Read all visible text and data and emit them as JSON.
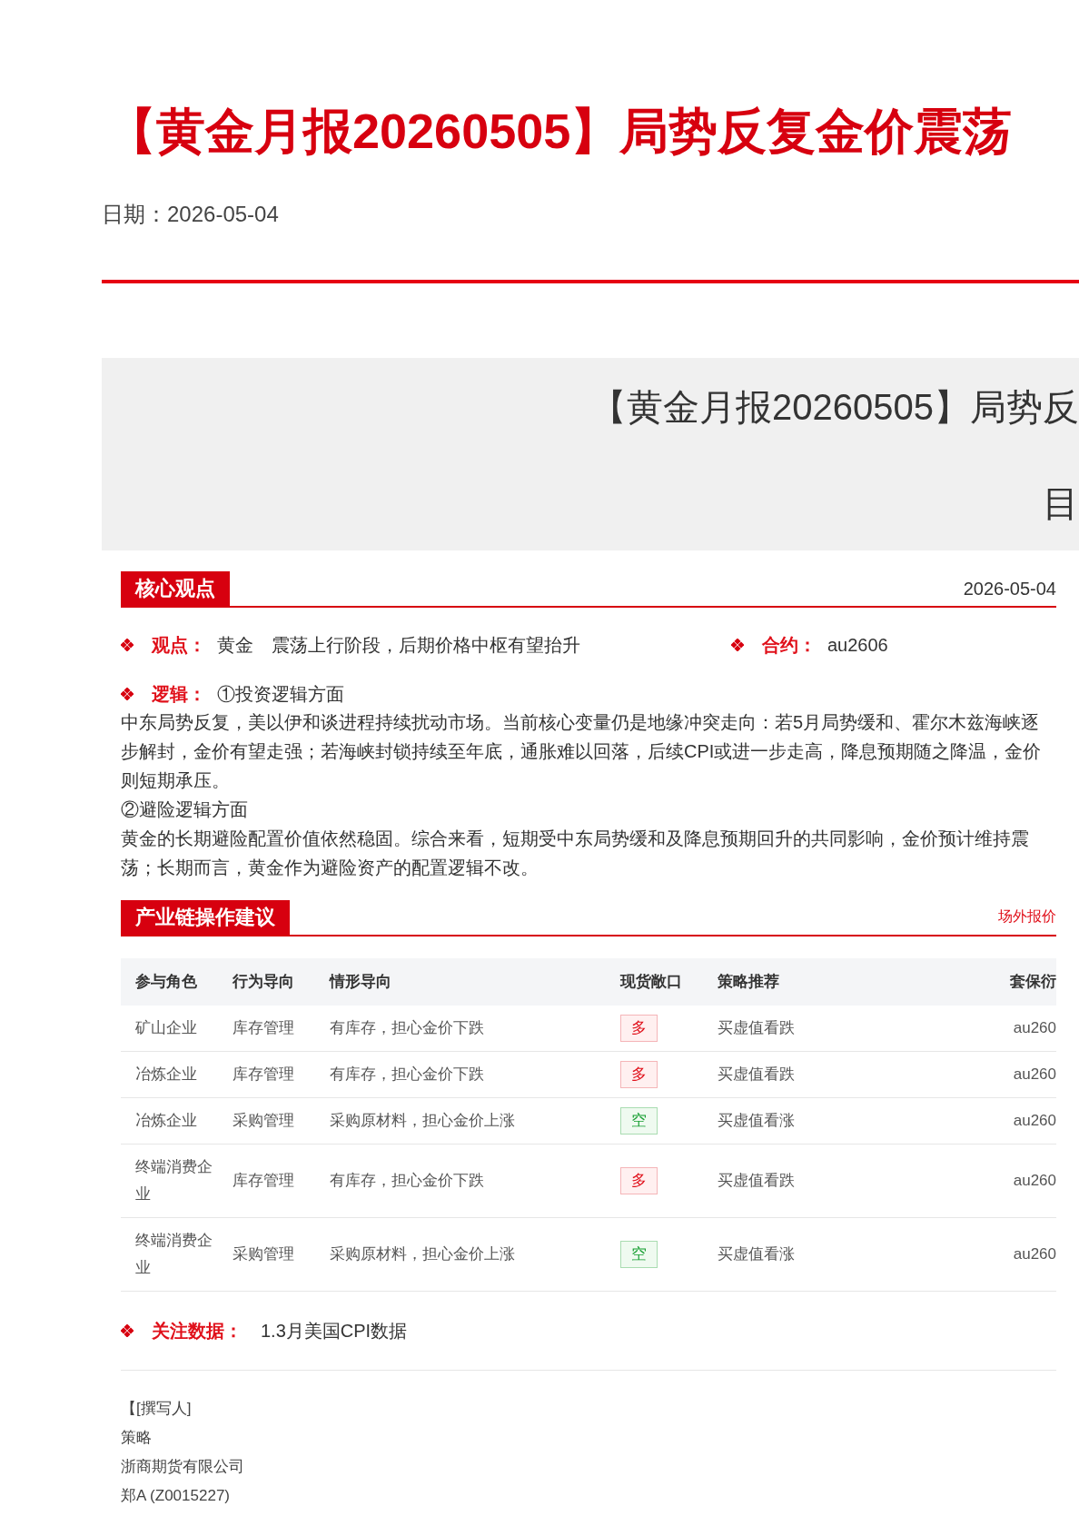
{
  "title": "【黄金月报20260505】局势反复金价震荡",
  "date_line": "日期：2026-05-04",
  "banner": {
    "title": "【黄金月报20260505】局势反",
    "subtitle": "目"
  },
  "core_view": {
    "heading": "核心观点",
    "date": "2026-05-04",
    "view": {
      "label": "观点：",
      "asset": "黄金",
      "text": "震荡上行阶段，后期价格中枢有望抬升"
    },
    "contract": {
      "label": "合约：",
      "value": "au2606"
    },
    "logic": {
      "label": "逻辑：",
      "first": "①投资逻辑方面",
      "paragraphs": [
        "中东局势反复，美以伊和谈进程持续扰动市场。当前核心变量仍是地缘冲突走向：若5月局势缓和、霍尔木兹海峡逐步解封，金价有望走强；若海峡封锁持续至年底，通胀难以回落，后续CPI或进一步走高，降息预期随之降温，金价则短期承压。",
        "②避险逻辑方面",
        "黄金的长期避险配置价值依然稳固。综合来看，短期受中东局势缓和及降息预期回升的共同影响，金价预计维持震荡；长期而言，黄金作为避险资产的配置逻辑不改。"
      ]
    }
  },
  "chain": {
    "heading": "产业链操作建议",
    "link": "场外报价",
    "columns": [
      "参与角色",
      "行为导向",
      "情形导向",
      "现货敞口",
      "策略推荐",
      "套保衍"
    ],
    "rows": [
      {
        "role": "矿山企业",
        "behavior": "库存管理",
        "situation": "有库存，担心金价下跌",
        "exposure": {
          "text": "多",
          "kind": "long"
        },
        "strategy": "买虚值看跌",
        "column_6": "au260"
      },
      {
        "role": "冶炼企业",
        "behavior": "库存管理",
        "situation": "有库存，担心金价下跌",
        "exposure": {
          "text": "多",
          "kind": "long"
        },
        "strategy": "买虚值看跌",
        "column_6": "au260"
      },
      {
        "role": "冶炼企业",
        "behavior": "采购管理",
        "situation": "采购原材料，担心金价上涨",
        "exposure": {
          "text": "空",
          "kind": "short"
        },
        "strategy": "买虚值看涨",
        "column_6": "au260"
      },
      {
        "role": "终端消费企业",
        "behavior": "库存管理",
        "situation": "有库存，担心金价下跌",
        "exposure": {
          "text": "多",
          "kind": "long"
        },
        "strategy": "买虚值看跌",
        "column_6": "au260"
      },
      {
        "role": "终端消费企业",
        "behavior": "采购管理",
        "situation": "采购原材料，担心金价上涨",
        "exposure": {
          "text": "空",
          "kind": "short"
        },
        "strategy": "买虚值看涨",
        "column_6": "au260"
      }
    ]
  },
  "focus": {
    "label": "关注数据：",
    "value": "1.3月美国CPI数据"
  },
  "author_lines": [
    "【[撰写人]",
    "策略",
    "浙商期货有限公司",
    "郑A (Z0015227)"
  ]
}
